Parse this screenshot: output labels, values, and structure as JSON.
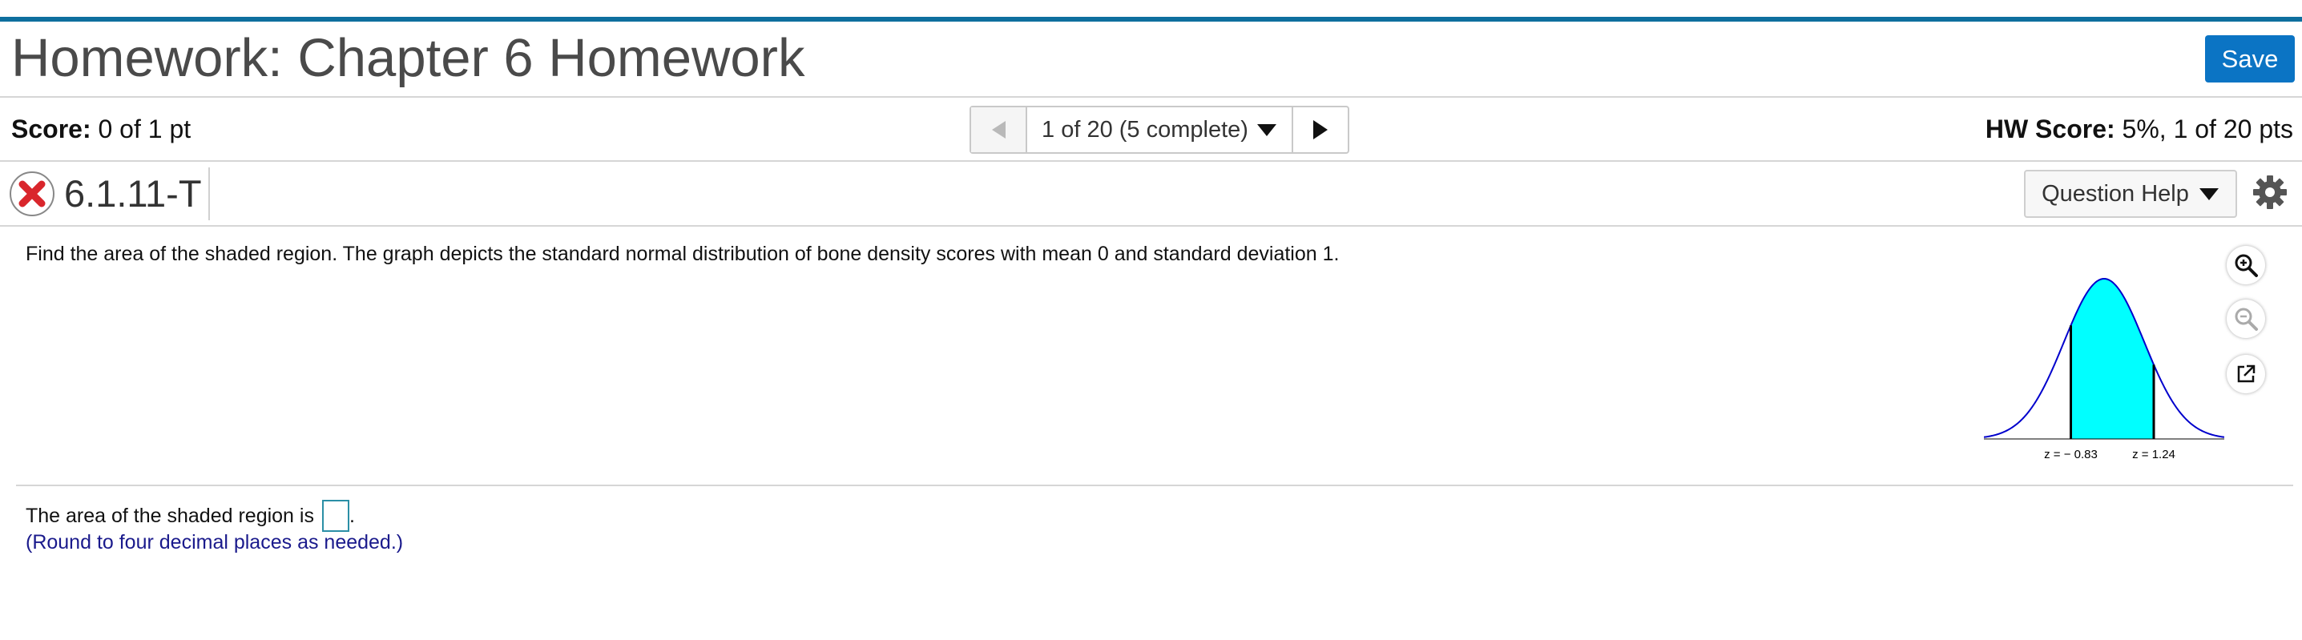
{
  "header": {
    "title": "Homework: Chapter 6 Homework",
    "save_label": "Save"
  },
  "status": {
    "score_label": "Score:",
    "score_value": "0 of 1 pt",
    "nav_position": "1 of 20 (5 complete)",
    "hw_score_label": "HW Score:",
    "hw_score_value": "5%, 1 of 20 pts"
  },
  "question": {
    "id": "6.1.11-T",
    "help_label": "Question Help",
    "text": "Find the area of the shaded region. The graph depicts the standard normal distribution of bone density scores with mean 0 and standard deviation 1.",
    "answer_prefix": "The area of the shaded region is",
    "answer_suffix": ".",
    "hint": "(Round to four decimal places as needed.)"
  },
  "graph": {
    "z_left_label": "z = − 0.83",
    "z_right_label": "z = 1.24"
  },
  "chart_data": {
    "type": "area",
    "title": "",
    "distribution": "standard normal",
    "mean": 0,
    "sd": 1,
    "shaded_from_z": -0.83,
    "shaded_to_z": 1.24,
    "xlim": [
      -3,
      3
    ],
    "tick_labels": [
      "z = − 0.83",
      "z = 1.24"
    ],
    "colors": {
      "curve": "#0000cc",
      "fill": "#00ffff",
      "boundary": "#000000"
    }
  },
  "icons": {
    "incorrect": "x-circle-icon",
    "settings": "gear-icon",
    "zoom_in": "zoom-in-icon",
    "zoom_out": "zoom-out-icon",
    "popout": "external-link-icon"
  },
  "colors": {
    "accent_bar": "#0e6f9e",
    "save_button": "#0b74c4",
    "hint_text": "#1a1a8c",
    "incorrect_red": "#d9262c"
  }
}
